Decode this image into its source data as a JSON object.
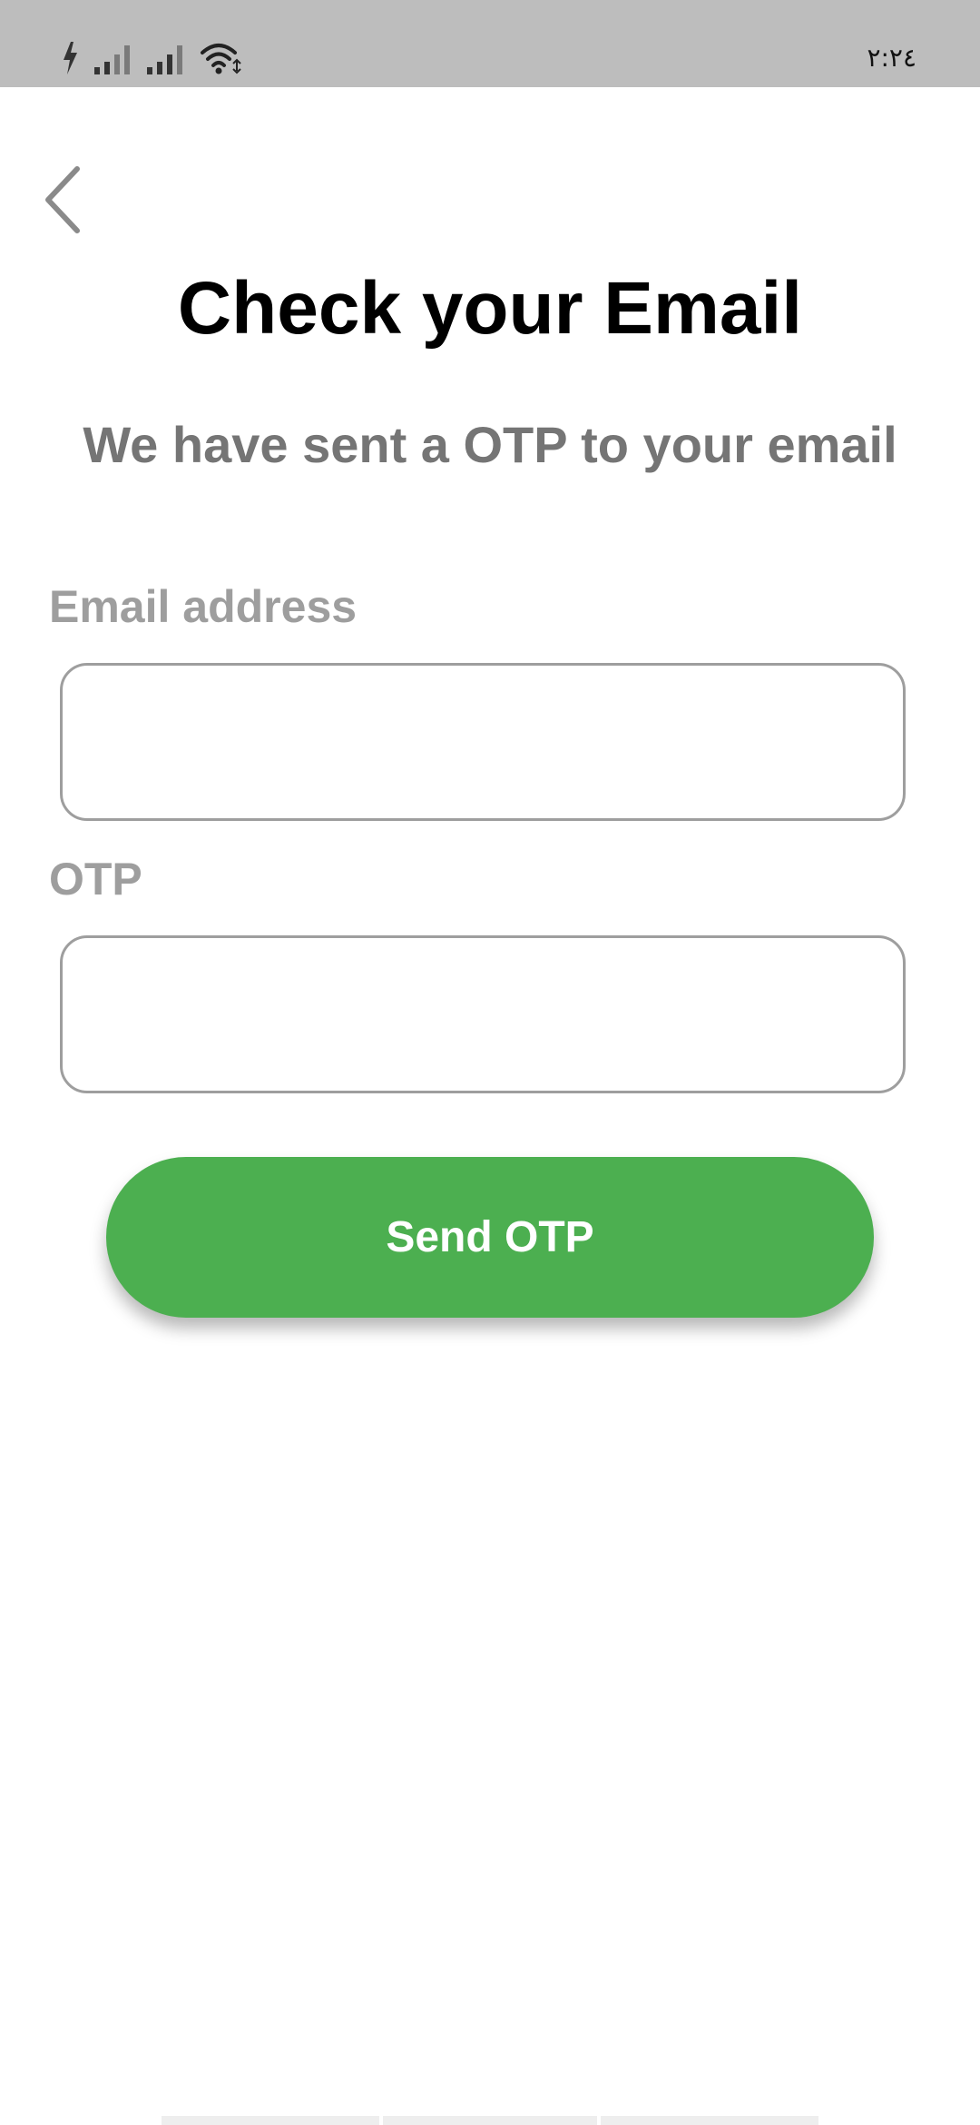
{
  "status_bar": {
    "time": "٢:٢٤",
    "icons": [
      "charging-bolt-icon",
      "signal-strength-icon",
      "signal-strength-icon",
      "wifi-icon"
    ]
  },
  "header": {
    "back_icon": "chevron-left-icon"
  },
  "page": {
    "title": "Check your Email",
    "subtitle": "We have sent a OTP to your email"
  },
  "form": {
    "email_label": "Email address",
    "email_value": "",
    "otp_label": "OTP",
    "otp_value": "",
    "submit_label": "Send OTP"
  },
  "colors": {
    "status_bar": "#bdbdbd",
    "accent": "#4caf50",
    "label": "#9e9e9e",
    "subtitle": "#757575",
    "title": "#000000"
  }
}
